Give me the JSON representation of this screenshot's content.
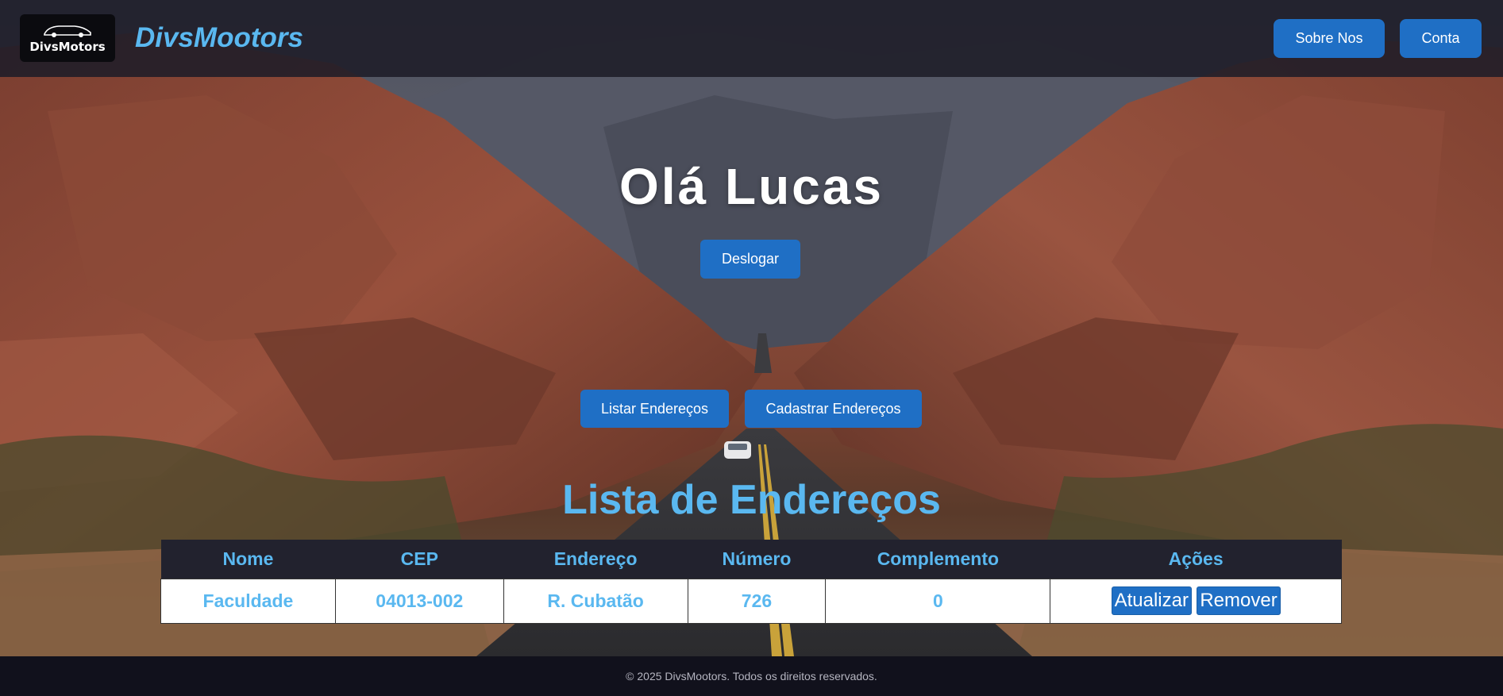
{
  "header": {
    "logo_text": "DivsMotors",
    "brand": "DivsMootors",
    "nav": [
      {
        "label": "Sobre Nos"
      },
      {
        "label": "Conta"
      }
    ]
  },
  "greeting": "Olá Lucas",
  "actions": {
    "logout_label": "Deslogar",
    "list_label": "Listar Endereços",
    "register_label": "Cadastrar Endereços"
  },
  "list": {
    "title": "Lista de Endereços",
    "columns": [
      "Nome",
      "CEP",
      "Endereço",
      "Número",
      "Complemento",
      "Ações"
    ],
    "rows": [
      {
        "nome": "Faculdade",
        "cep": "04013-002",
        "endereco": "R. Cubatão",
        "numero": "726",
        "complemento": "0",
        "update_label": "Atualizar",
        "remove_label": "Remover"
      }
    ]
  },
  "footer": "© 2025 DivsMootors. Todos os direitos reservados.",
  "colors": {
    "accent": "#1f6fc5",
    "brand_text": "#5ab8f0",
    "header_bg": "#1e1c28",
    "footer_bg": "#11111c"
  }
}
